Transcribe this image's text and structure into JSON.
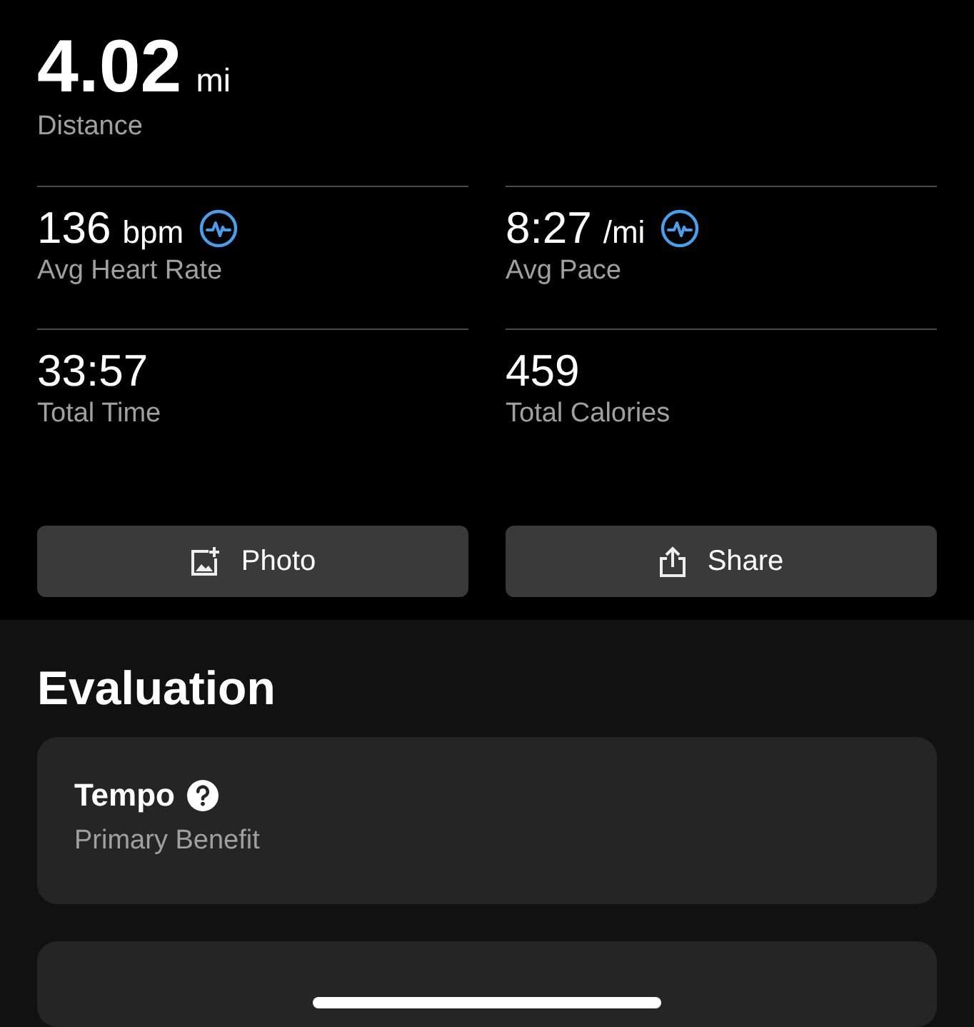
{
  "distance": {
    "value": "4.02",
    "unit": "mi",
    "label": "Distance"
  },
  "stats": [
    {
      "value": "136",
      "unit": "bpm",
      "label": "Avg Heart Rate",
      "trend_icon": true
    },
    {
      "value": "8:27",
      "unit": "/mi",
      "label": "Avg Pace",
      "trend_icon": true
    },
    {
      "value": "33:57",
      "label": "Total Time",
      "trend_icon": false
    },
    {
      "value": "459",
      "label": "Total Calories",
      "trend_icon": false
    }
  ],
  "buttons": [
    {
      "label": "Photo",
      "kind": "photo"
    },
    {
      "label": "Share",
      "kind": "share"
    }
  ],
  "evaluation": {
    "title": "Evaluation",
    "card": {
      "title": "Tempo",
      "subtitle": "Primary Benefit"
    }
  }
}
